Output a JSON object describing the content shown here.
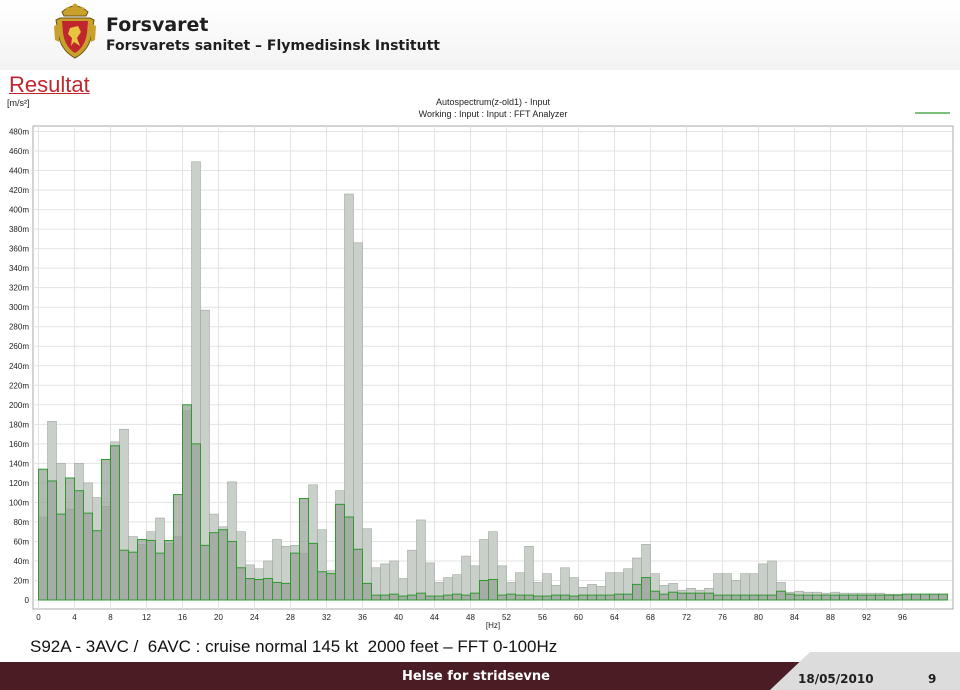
{
  "header": {
    "org_name": "Forsvaret",
    "org_sub": "Forsvarets sanitet – Flymedisinsk Institutt"
  },
  "slide_title": "Resultat",
  "caption": "S92A - 3AVC /  6AVC : cruise normal 145 kt  2000 feet – FFT 0-100Hz",
  "footer": {
    "text": "Helse for stridsevne",
    "date": "18/05/2010",
    "page": "9"
  },
  "colors": {
    "title_red": "#c0262d",
    "footer_bg": "#4a1d25",
    "footer_wedge": "#dcdcdc",
    "series_fill_light": "#c9cfc9",
    "series_fill_dark": "#9aa19a",
    "series_stroke": "#2e9a2e"
  },
  "chart_data": {
    "type": "bar",
    "title": "Autospectrum(z-old1) - Input",
    "subtitle": "Working : Input : Input : FFT Analyzer",
    "ylabel": "[m/s²]",
    "xlabel": "[Hz]",
    "xlim": [
      0,
      101
    ],
    "ylim": [
      0,
      490
    ],
    "grid": true,
    "bin_width": 1,
    "xticks": [
      0,
      4,
      8,
      12,
      16,
      20,
      24,
      28,
      32,
      36,
      40,
      44,
      48,
      52,
      56,
      60,
      64,
      68,
      72,
      76,
      80,
      84,
      88,
      92,
      96
    ],
    "yticks": [
      0,
      20,
      40,
      60,
      80,
      100,
      120,
      140,
      160,
      180,
      200,
      220,
      240,
      260,
      280,
      300,
      320,
      340,
      360,
      380,
      400,
      420,
      440,
      460,
      480
    ],
    "ytick_unit": "m",
    "series": [
      {
        "style": "gray-envelope",
        "values": [
          85,
          183,
          140,
          93,
          140,
          120,
          105,
          96,
          162,
          175,
          65,
          57,
          70,
          84,
          58,
          65,
          194,
          449,
          297,
          88,
          75,
          121,
          70,
          36,
          32,
          40,
          62,
          55,
          56,
          48,
          118,
          72,
          30,
          112,
          416,
          366,
          73,
          33,
          37,
          40,
          22,
          51,
          82,
          38,
          18,
          23,
          26,
          45,
          35,
          62,
          70,
          35,
          18,
          28,
          55,
          18,
          27,
          15,
          33,
          23,
          13,
          16,
          14,
          28,
          28,
          32,
          43,
          57,
          27,
          15,
          17,
          10,
          12,
          10,
          12,
          27,
          27,
          20,
          27,
          27,
          37,
          40,
          18,
          8,
          9,
          8,
          8,
          7,
          8,
          7,
          7,
          7,
          7,
          7,
          6,
          6,
          6,
          6,
          6,
          6,
          6
        ]
      },
      {
        "style": "green-outline",
        "values": [
          134,
          122,
          88,
          125,
          112,
          89,
          71,
          144,
          158,
          51,
          49,
          62,
          61,
          48,
          61,
          108,
          200,
          160,
          56,
          69,
          72,
          60,
          33,
          22,
          21,
          22,
          18,
          17,
          48,
          104,
          58,
          29,
          27,
          98,
          85,
          52,
          17,
          5,
          5,
          6,
          4,
          5,
          7,
          4,
          4,
          5,
          6,
          5,
          7,
          20,
          21,
          5,
          6,
          5,
          5,
          4,
          4,
          5,
          5,
          4,
          5,
          5,
          5,
          5,
          6,
          6,
          16,
          23,
          9,
          6,
          8,
          7,
          7,
          7,
          7,
          5,
          5,
          5,
          5,
          5,
          5,
          5,
          9,
          6,
          5,
          5,
          5,
          5,
          5,
          5,
          5,
          5,
          5,
          5,
          5,
          5,
          6,
          6,
          6,
          6,
          6
        ]
      }
    ]
  }
}
